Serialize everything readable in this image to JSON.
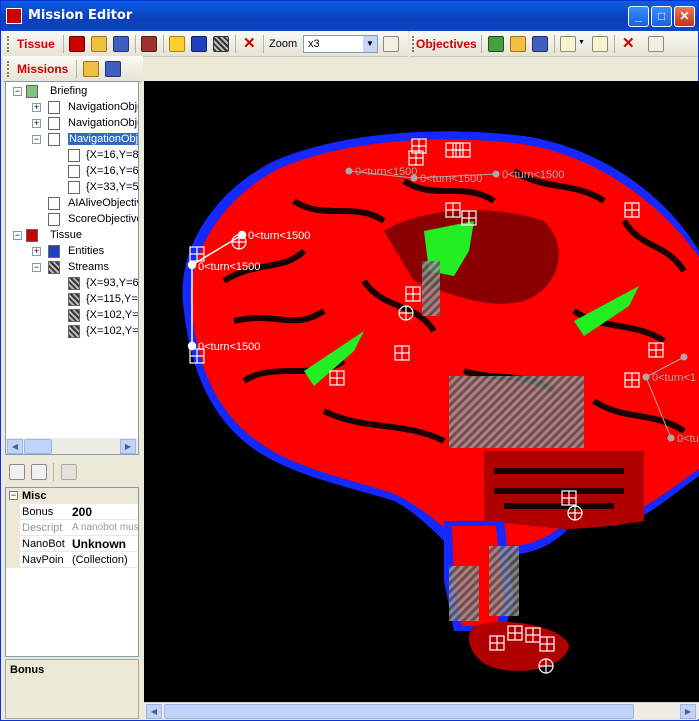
{
  "window": {
    "title": "Mission Editor",
    "minimize": "_",
    "maximize": "□",
    "close": "✕"
  },
  "toolbar_tissue": {
    "label": "Tissue",
    "zoom_label": "Zoom",
    "zoom_value": "x3"
  },
  "toolbar_objectives": {
    "label": "Objectives"
  },
  "toolbar_missions": {
    "label": "Missions"
  },
  "tree": {
    "briefing": "Briefing",
    "nav1": "NavigationObje",
    "nav2": "NavigationObje",
    "nav3": "NavigationObje",
    "pt1": "{X=16,Y=8",
    "pt2": "{X=16,Y=6",
    "pt3": "{X=33,Y=5",
    "alive": "AIAliveObjectiv",
    "score": "ScoreObjective",
    "tissue": "Tissue",
    "entities": "Entities",
    "streams": "Streams",
    "s1": "{X=93,Y=6",
    "s2": "{X=115,Y=",
    "s3": "{X=102,Y=",
    "s4": "{X=102,Y="
  },
  "properties": {
    "category": "Misc",
    "rows": [
      {
        "name": "Bonus",
        "value": "200"
      },
      {
        "name": "Descript",
        "value": "A nanobot mus"
      },
      {
        "name": "NanoBot",
        "value": "Unknown"
      },
      {
        "name": "NavPoin",
        "value": "(Collection)"
      }
    ],
    "description_title": "Bonus"
  },
  "map": {
    "waypoint_labels": [
      "0<turn<1500",
      "0<turn<1500",
      "0<turn<1500",
      "0<turn<1500",
      "0<turn<1500",
      "0<turn<1500",
      "0<turn<1500",
      "0<turn<1500",
      "0<turn<1"
    ]
  },
  "colors": {
    "tissue_red": "#ff0000",
    "dark_red": "#b00000",
    "membrane_blue": "#1428ff",
    "nerve_green": "#22ee22",
    "accent": "#d00000"
  }
}
